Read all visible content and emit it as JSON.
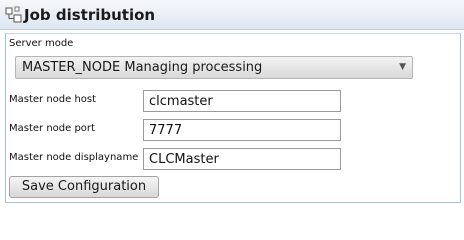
{
  "window": {
    "title": "Job distribution",
    "icon": "network-nodes-icon"
  },
  "server_mode": {
    "label": "Server mode",
    "selected": "MASTER_NODE Managing processing"
  },
  "fields": {
    "host": {
      "label": "Master node host",
      "value": "clcmaster"
    },
    "port": {
      "label": "Master node port",
      "value": "7777"
    },
    "displayname": {
      "label": "Master node displayname",
      "value": "CLCMaster"
    }
  },
  "actions": {
    "save_label": "Save Configuration"
  }
}
